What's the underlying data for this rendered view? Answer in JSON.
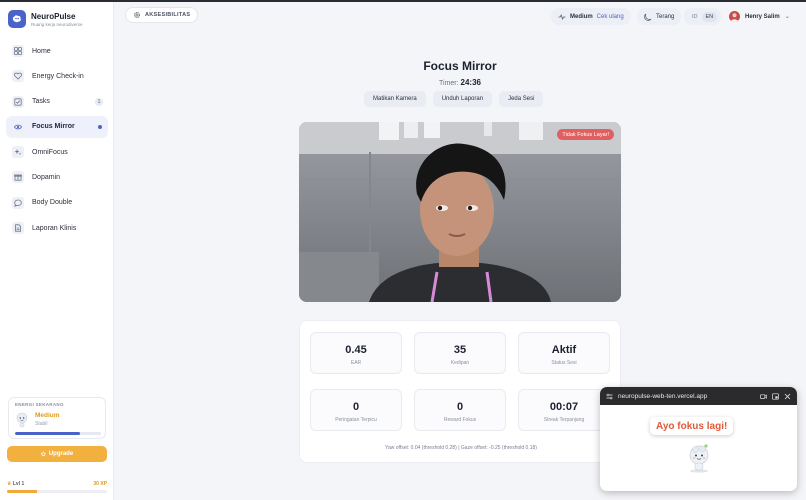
{
  "brand": {
    "name": "NeuroPulse",
    "tagline": "Ruang kerja neurodiverse"
  },
  "nav": [
    {
      "label": "Home",
      "icon": "grid-icon"
    },
    {
      "label": "Energy Check-in",
      "icon": "heart-icon"
    },
    {
      "label": "Tasks",
      "icon": "checkbox-icon",
      "badge": "1"
    },
    {
      "label": "Focus Mirror",
      "icon": "eye-icon",
      "active": true
    },
    {
      "label": "OmniFocus",
      "icon": "sparkle-icon"
    },
    {
      "label": "Dopamin",
      "icon": "gift-icon"
    },
    {
      "label": "Body Double",
      "icon": "chat-icon"
    },
    {
      "label": "Laporan Klinis",
      "icon": "document-icon"
    }
  ],
  "energy": {
    "title": "ENERGI SEKARANG",
    "level": "Medium",
    "sub": "Stabil",
    "fill_fraction": 0.75
  },
  "upgrade_label": "Upgrade",
  "level": {
    "label": "Lvl 1",
    "xp": "30 XP",
    "fill_fraction": 0.3
  },
  "header": {
    "accessibility_label": "AKSESIBILITAS",
    "energy_pill": {
      "level": "Medium",
      "link": "Cek ulang"
    },
    "theme_label": "Terang",
    "lang": [
      "ID",
      "EN"
    ],
    "user_name": "Henry Salim"
  },
  "main": {
    "title": "Focus Mirror",
    "timer_label": "Timer:",
    "timer_value": "24:36",
    "actions": [
      "Matikan Kamera",
      "Unduh Laporan",
      "Jeda Sesi"
    ],
    "warning_tag": "Tidak Fokus Layar!"
  },
  "stats": [
    {
      "value": "0.45",
      "label": "EAR"
    },
    {
      "value": "35",
      "label": "Kedipan"
    },
    {
      "value": "Aktif",
      "label": "Status Sesi"
    },
    {
      "value": "0",
      "label": "Peringatan Terpicu"
    },
    {
      "value": "0",
      "label": "Reward Fokus"
    },
    {
      "value": "00:07",
      "label": "Streak Terpanjang"
    }
  ],
  "offset_text": "Yaw offset: 0.04 (threshold 0.28) | Gaze offset: -0.25 (threshold 0.18)",
  "pip": {
    "url": "neuropulse-web-ten.vercel.app",
    "message": "Ayo fokus lagi!"
  },
  "colors": {
    "accent": "#4a63c9",
    "upgrade": "#f2b13f",
    "warning": "#e06060"
  }
}
